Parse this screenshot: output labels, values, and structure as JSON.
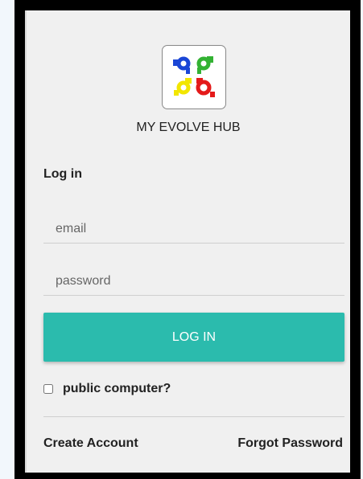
{
  "app": {
    "name": "MY EVOLVE HUB",
    "logo": "evolve-hub-logo",
    "logo_colors": [
      "#1a46d6",
      "#33b233",
      "#f2e600",
      "#e41a1a"
    ]
  },
  "login": {
    "heading": "Log in",
    "email_placeholder": "email",
    "password_placeholder": "password",
    "submit_label": "LOG IN",
    "public_computer_label": "public computer?",
    "public_computer_checked": false
  },
  "links": {
    "create_account": "Create Account",
    "forgot_password": "Forgot Password"
  },
  "colors": {
    "accent": "#2bbbad",
    "background": "#f0f0f0",
    "frame": "#000000"
  }
}
